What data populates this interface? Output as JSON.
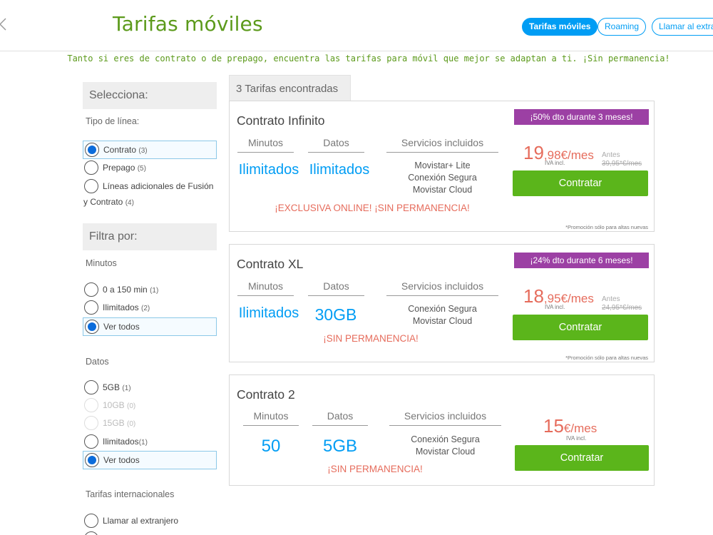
{
  "header": {
    "title": "Tarifas móviles",
    "nav": [
      {
        "label": "Tarifas móviles",
        "active": true
      },
      {
        "label": "Roaming",
        "active": false
      },
      {
        "label": "Llamar al extra",
        "active": false
      }
    ]
  },
  "tagline": "Tanto si eres de contrato o de prepago, encuentra las tarifas para móvil que mejor se adaptan a ti. ¡Sin permanencia!",
  "sidebar": {
    "select_heading": "Selecciona:",
    "line_type_label": "Tipo de línea:",
    "line_types": [
      {
        "label": "Contrato",
        "count": "(3)",
        "selected": true
      },
      {
        "label": "Prepago",
        "count": "(5)",
        "selected": false
      },
      {
        "label": "Líneas adicionales de Fusión",
        "label_cont": "y Contrato",
        "count": "(4)",
        "selected": false
      }
    ],
    "filter_heading": "Filtra por:",
    "minutes_label": "Minutos",
    "minutes": [
      {
        "label": "0 a 150 min",
        "count": "(1)",
        "selected": false
      },
      {
        "label": "Ilimitados",
        "count": "(2)",
        "selected": false
      },
      {
        "label": "Ver todos",
        "count": "",
        "selected": true
      }
    ],
    "data_label": "Datos",
    "data": [
      {
        "label": "5GB",
        "count": "(1)",
        "selected": false,
        "disabled": false
      },
      {
        "label": "10GB",
        "count": "(0)",
        "selected": false,
        "disabled": true
      },
      {
        "label": "15GB",
        "count": "(0)",
        "selected": false,
        "disabled": true
      },
      {
        "label": "Ilimitados",
        "count": "(1)",
        "selected": false,
        "disabled": false
      },
      {
        "label": "Ver todos",
        "count": "",
        "selected": true,
        "disabled": false
      }
    ],
    "intl_label": "Tarifas internacionales",
    "intl": [
      {
        "label": "Llamar al extranjero",
        "selected": false
      }
    ]
  },
  "results": {
    "count_label": "3 Tarifas encontradas",
    "col_minutes": "Minutos",
    "col_data": "Datos",
    "col_services": "Servicios incluidos",
    "cta_label": "Contratar",
    "iva_label": "IVA incl.",
    "antes_label": "Antes",
    "footnote": "*Promoción sólo para altas nuevas",
    "plans": [
      {
        "name": "Contrato Infinito",
        "promo": "¡50% dto durante 3 meses!",
        "minutes": "Ilimitados",
        "data": "Ilimitados",
        "services": [
          "Movistar+ Lite",
          "Conexión Segura",
          "Movistar Cloud"
        ],
        "alert": "¡EXCLUSIVA ONLINE! ¡SIN PERMANENCIA!",
        "price_int": "19",
        "price_dec": ",98",
        "price_suffix": "€/mes",
        "old_price": "39,95*€/mes"
      },
      {
        "name": "Contrato XL",
        "promo": "¡24% dto durante 6 meses!",
        "minutes": "Ilimitados",
        "data": "30GB",
        "services": [
          "Conexión Segura",
          "Movistar Cloud"
        ],
        "alert": "¡SIN PERMANENCIA!",
        "price_int": "18",
        "price_dec": ",95",
        "price_suffix": "€/mes",
        "old_price": "24,95*€/mes"
      },
      {
        "name": "Contrato 2",
        "minutes": "50",
        "data": "5GB",
        "services": [
          "Conexión Segura",
          "Movistar Cloud"
        ],
        "alert": "¡SIN PERMANENCIA!",
        "price_int": "15",
        "price_suffix": "€/mes"
      }
    ]
  },
  "colors": {
    "brand_green": "#5c9a1b",
    "accent_blue": "#019df4",
    "cta_green": "#5bb51b",
    "promo_purple": "#9c40a4",
    "alert_red": "#e66c5c"
  }
}
